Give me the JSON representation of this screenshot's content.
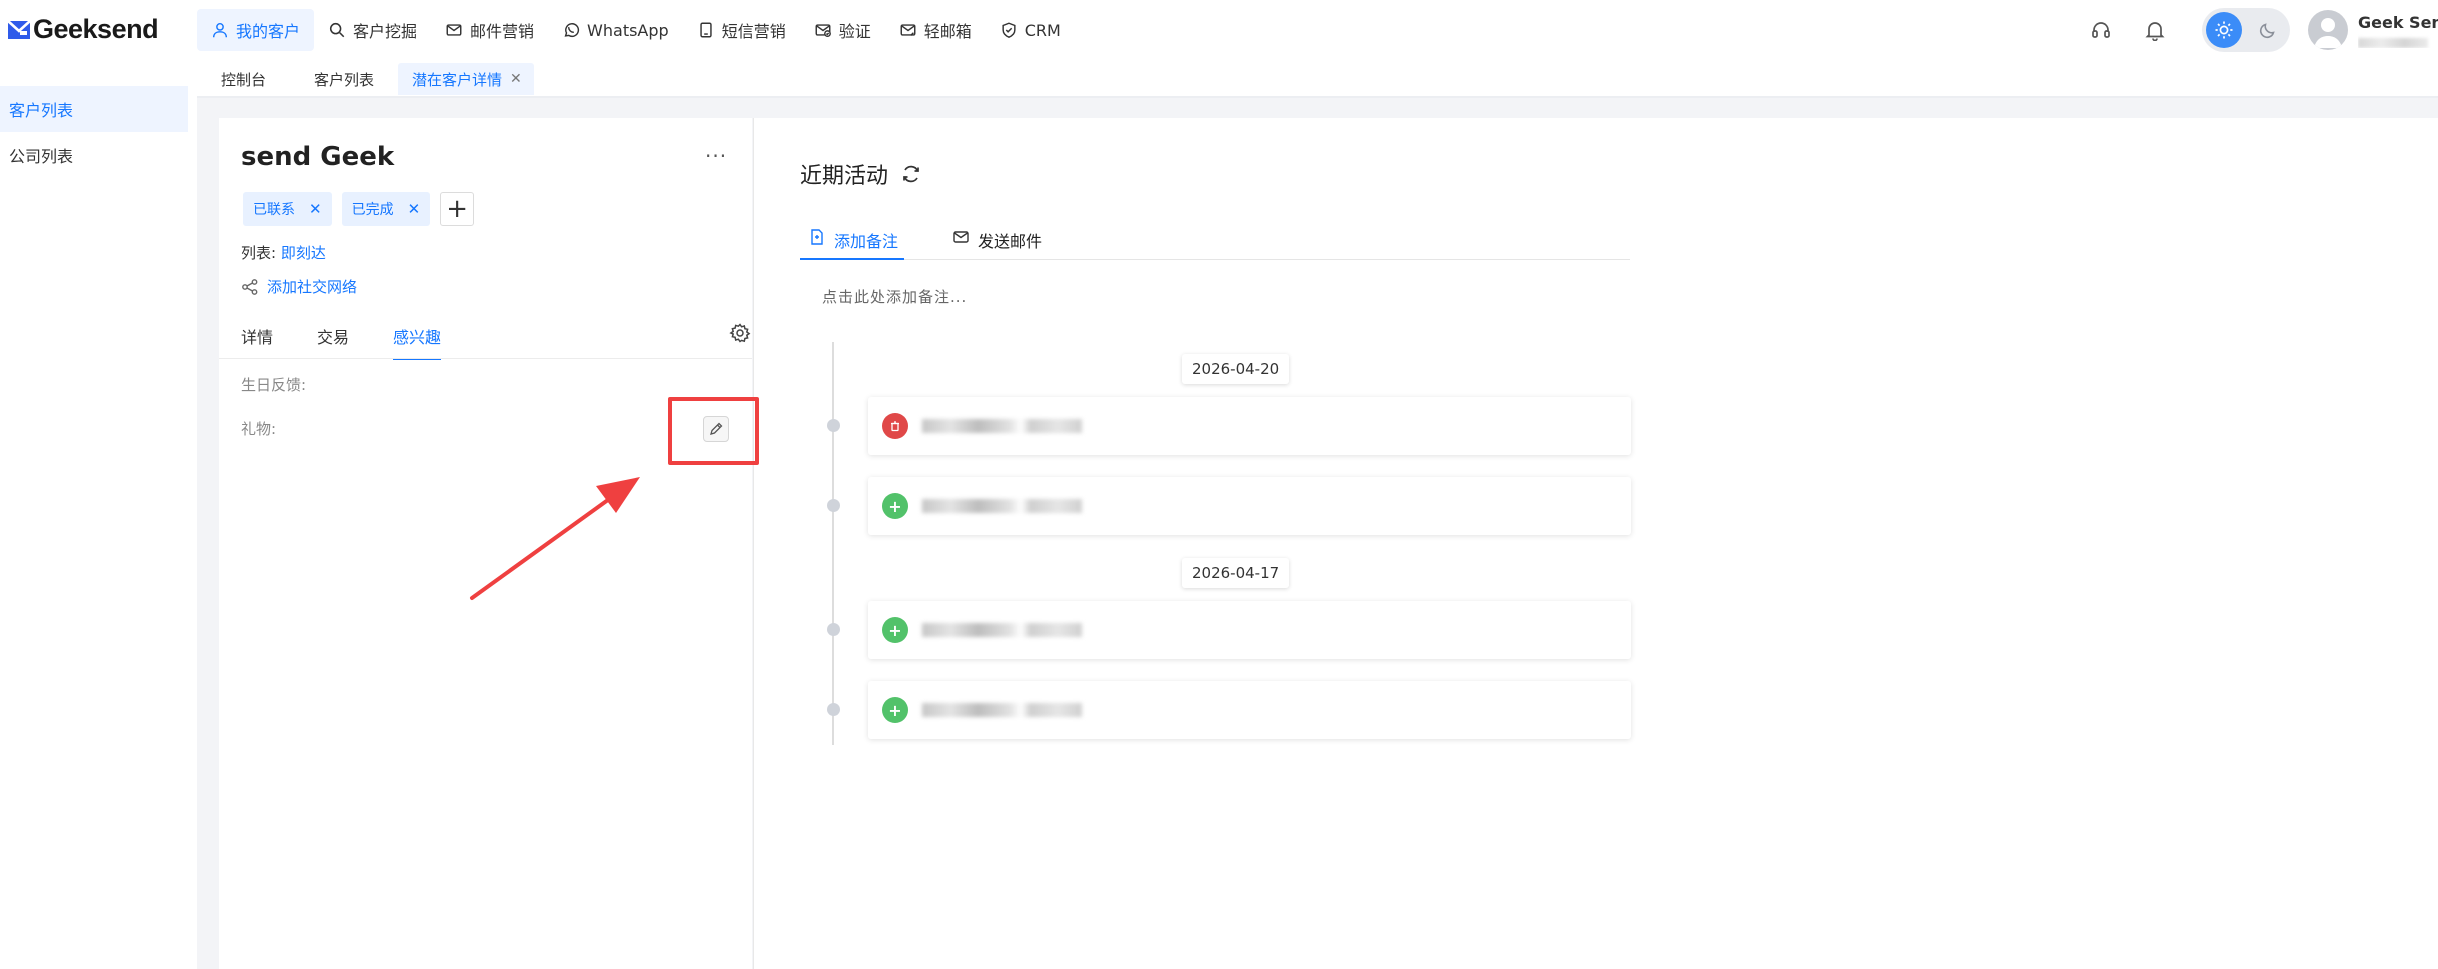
{
  "app": {
    "brand": "Geeksend"
  },
  "nav": {
    "items": [
      {
        "label": "我的客户",
        "icon": "user-icon",
        "active": true
      },
      {
        "label": "客户挖掘",
        "icon": "search-icon"
      },
      {
        "label": "邮件营销",
        "icon": "mail-icon"
      },
      {
        "label": "WhatsApp",
        "icon": "whatsapp-icon"
      },
      {
        "label": "短信营销",
        "icon": "sms-icon"
      },
      {
        "label": "验证",
        "icon": "verify-icon"
      },
      {
        "label": "轻邮箱",
        "icon": "light-mail-icon"
      },
      {
        "label": "CRM",
        "icon": "crm-icon"
      }
    ]
  },
  "user": {
    "name": "Geek Send"
  },
  "subtabs": {
    "items": [
      {
        "label": "控制台"
      },
      {
        "label": "客户列表"
      },
      {
        "label": "潜在客户详情",
        "active": true,
        "closable": true
      }
    ]
  },
  "sidebar": {
    "items": [
      {
        "label": "客户列表",
        "active": true
      },
      {
        "label": "公司列表"
      }
    ]
  },
  "contact": {
    "name": "send Geek",
    "more": "···",
    "tags": [
      "已联系",
      "已完成"
    ],
    "list_label": "列表:",
    "list_value": "即刻达",
    "social_link": "添加社交网络",
    "tabs": [
      {
        "label": "详情"
      },
      {
        "label": "交易"
      },
      {
        "label": "感兴趣",
        "active": true
      }
    ],
    "fields": [
      {
        "label": "生日反馈:"
      },
      {
        "label": "礼物:"
      }
    ]
  },
  "activity": {
    "title": "近期活动",
    "tabs": [
      {
        "label": "添加备注",
        "icon": "note-icon",
        "active": true
      },
      {
        "label": "发送邮件",
        "icon": "mail-icon"
      }
    ],
    "note_placeholder": "点击此处添加备注...",
    "groups": [
      {
        "date": "2026-04-20",
        "entries": [
          {
            "type": "delete",
            "icon_color": "#e04848"
          },
          {
            "type": "add",
            "icon_color": "#52c26a"
          }
        ]
      },
      {
        "date": "2026-04-17",
        "entries": [
          {
            "type": "add",
            "icon_color": "#52c26a"
          },
          {
            "type": "add",
            "icon_color": "#52c26a"
          }
        ]
      }
    ]
  },
  "colors": {
    "accent": "#1677ff",
    "annotation": "#ef4040"
  }
}
